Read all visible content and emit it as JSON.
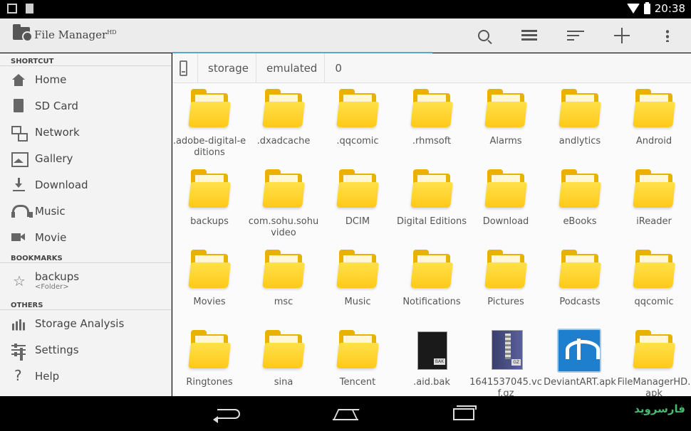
{
  "status_bar": {
    "time": "20:38"
  },
  "action_bar": {
    "title": "File Manager",
    "title_badge": "HD",
    "actions": [
      "search-icon",
      "view-list-icon",
      "sort-icon",
      "add-icon",
      "overflow-menu-icon"
    ]
  },
  "sidebar": {
    "shortcut_header": "SHORTCUT",
    "shortcuts": [
      {
        "label": "Home",
        "icon": "home-icon"
      },
      {
        "label": "SD Card",
        "icon": "sd-card-icon"
      },
      {
        "label": "Network",
        "icon": "network-icon"
      },
      {
        "label": "Gallery",
        "icon": "gallery-icon"
      },
      {
        "label": "Download",
        "icon": "download-icon"
      },
      {
        "label": "Music",
        "icon": "headphones-icon"
      },
      {
        "label": "Movie",
        "icon": "video-icon"
      }
    ],
    "bookmarks_header": "BOOKMARKS",
    "bookmarks": [
      {
        "label": "backups",
        "sub": "<Folder>"
      }
    ],
    "others_header": "OTHERS",
    "others": [
      {
        "label": "Storage Analysis",
        "icon": "chart-icon"
      },
      {
        "label": "Settings",
        "icon": "settings-icon"
      },
      {
        "label": "Help",
        "icon": "help-icon"
      }
    ]
  },
  "breadcrumb": [
    "storage",
    "emulated",
    "0"
  ],
  "items": [
    {
      "label": ".adobe-digital-editions",
      "type": "folder"
    },
    {
      "label": ".dxadcache",
      "type": "folder"
    },
    {
      "label": ".qqcomic",
      "type": "folder"
    },
    {
      "label": ".rhmsoft",
      "type": "folder"
    },
    {
      "label": "Alarms",
      "type": "folder"
    },
    {
      "label": "andlytics",
      "type": "folder"
    },
    {
      "label": "Android",
      "type": "folder"
    },
    {
      "label": "backups",
      "type": "folder"
    },
    {
      "label": "com.sohu.sohuvideo",
      "type": "folder"
    },
    {
      "label": "DCIM",
      "type": "folder"
    },
    {
      "label": "Digital Editions",
      "type": "folder"
    },
    {
      "label": "Download",
      "type": "folder"
    },
    {
      "label": "eBooks",
      "type": "folder"
    },
    {
      "label": "iReader",
      "type": "folder"
    },
    {
      "label": "Movies",
      "type": "folder"
    },
    {
      "label": "msc",
      "type": "folder"
    },
    {
      "label": "Music",
      "type": "folder"
    },
    {
      "label": "Notifications",
      "type": "folder"
    },
    {
      "label": "Pictures",
      "type": "folder"
    },
    {
      "label": "Podcasts",
      "type": "folder"
    },
    {
      "label": "qqcomic",
      "type": "folder"
    },
    {
      "label": "Ringtones",
      "type": "folder"
    },
    {
      "label": "sina",
      "type": "folder"
    },
    {
      "label": "Tencent",
      "type": "folder"
    },
    {
      "label": ".aid.bak",
      "type": "bak"
    },
    {
      "label": "1641537045.vcf.gz",
      "type": "gz"
    },
    {
      "label": "DeviantART.apk",
      "type": "apk"
    },
    {
      "label": "FileManagerHD.apk",
      "type": "folder"
    }
  ],
  "watermark": "فارسروید"
}
